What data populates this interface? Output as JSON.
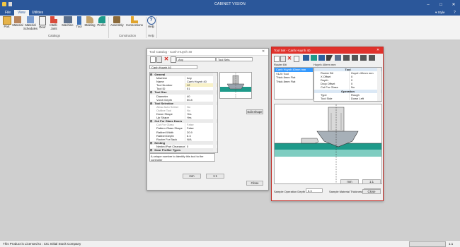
{
  "app": {
    "title": "CABINET VISION"
  },
  "tabs": [
    "File",
    "View",
    "Utilities"
  ],
  "ribbon": {
    "buttons": [
      "Part",
      "Material",
      "Material Schedules",
      "Door",
      "Intelli-Joint",
      "Machine",
      "Tool",
      "Molding",
      "Profile",
      "Assembly",
      "Connections",
      "Help"
    ],
    "groups": [
      "Catalogs",
      "Construction",
      "Help"
    ],
    "style_label": "Style"
  },
  "toolcat": {
    "title": "Tool Catalog - Canh Huynh 40",
    "filter1": "Any",
    "filter2": "Tool Sets",
    "selected_tool": "Canh Huynh 40",
    "description": "A unique number to identify this tool to the controller",
    "btn_mm": "mm",
    "btn_scale": "1:1",
    "btn_edit": "Edit Shape",
    "btn_close": "Close",
    "rows": [
      {
        "k": "General",
        "v": "",
        "cat": true
      },
      {
        "k": "Machine",
        "v": "Any"
      },
      {
        "k": "Name",
        "v": "Canh Huynh 40"
      },
      {
        "k": "Tool Number",
        "v": "12",
        "sel": true
      },
      {
        "k": "Tool ID",
        "v": "51"
      },
      {
        "k": "Tool Size",
        "v": "",
        "cat": true
      },
      {
        "k": "Diameter",
        "v": "40"
      },
      {
        "k": "Vorch Depth",
        "v": "50.8"
      },
      {
        "k": "Tool Selection",
        "v": "",
        "cat": true
      },
      {
        "k": "Allow Auto Select",
        "v": "No",
        "grey": true
      },
      {
        "k": "Outline Tool",
        "v": "No",
        "grey": true
      },
      {
        "k": "Down Shape",
        "v": "Yes"
      },
      {
        "k": "Up Shape",
        "v": "Yes"
      },
      {
        "k": "Cut For Glass Doors",
        "v": "",
        "cat": true
      },
      {
        "k": "Cut For Glass",
        "v": "False",
        "grey": true
      },
      {
        "k": "Pattern Glass Shape",
        "v": "False"
      },
      {
        "k": "Rabbet Width",
        "v": "20.9"
      },
      {
        "k": "Rabbet Depth",
        "v": "6.3"
      },
      {
        "k": "Router For Back",
        "v": "N/A"
      },
      {
        "k": "Nesting",
        "v": "",
        "cat": true
      },
      {
        "k": "Nested Part Clearance",
        "v": "0"
      },
      {
        "k": "Door Profiler Types",
        "v": "",
        "cat": true
      }
    ]
  },
  "toolset": {
    "title": "Tool Set - Canh Huynh 40",
    "router_bit_label": "Router Bit",
    "list": [
      "Canh Huynh 40mm mm",
      "V120 Tool",
      "Thick 8mm Flat",
      "Thick 8mm Flat"
    ],
    "props_header": "Huynh 40mm mm",
    "section_tool": "Tool",
    "section_op": "Operation",
    "props": [
      {
        "k": "Router Bit",
        "v": "Huynh 40mm mm"
      },
      {
        "k": "X Offset",
        "v": "0"
      },
      {
        "k": "Depth",
        "v": "0"
      },
      {
        "k": "Drop Offset",
        "v": "0"
      },
      {
        "k": "Cut For Glass",
        "v": "No"
      }
    ],
    "op_props": [
      {
        "k": "Type",
        "v": "Rough"
      },
      {
        "k": "Tool Side",
        "v": "Down Left"
      }
    ],
    "sample_depth_label": "Sample Operation Depth",
    "sample_depth": "6.3",
    "sample_thickness_label": "Sample Material Thickness",
    "sample_thickness": "20",
    "btn_mm": "mm",
    "btn_scale": "1:1",
    "btn_close": "Close"
  },
  "status": {
    "left": "This Product is Licensed to : CIC Initial Stock Company",
    "right": "1:1"
  },
  "colors": {
    "brand": "#2b579a",
    "accent_red": "#e0312b",
    "profile_teal": "#1e9a8a"
  }
}
